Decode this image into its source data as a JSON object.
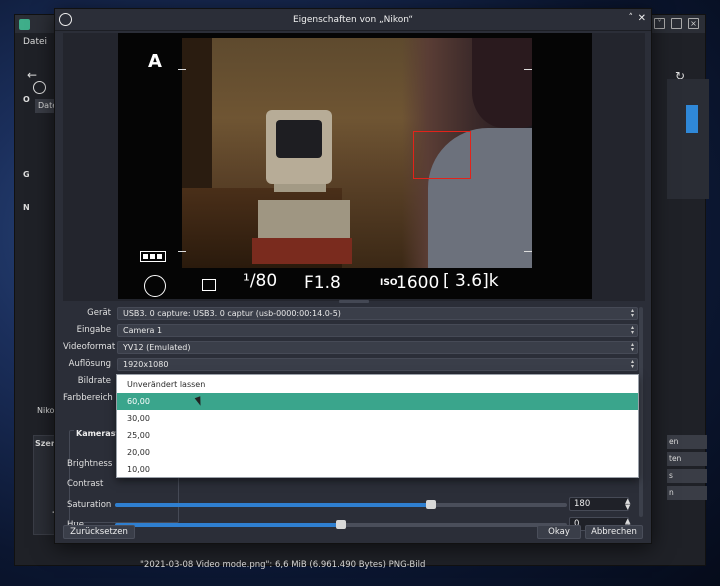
{
  "background_window": {
    "menu_item": "Datei",
    "left_letters": [
      "O",
      "G",
      "N"
    ],
    "date_tab": "Date",
    "nikon_label": "Nikon",
    "scenes_label": "Szene",
    "add_button": "+",
    "controls": [
      "en",
      "ten",
      "s",
      "n"
    ],
    "file_info": "\"2021-03-08 Video mode.png\": 6,6 MiB (6.961.490 Bytes) PNG-Bild"
  },
  "dialog": {
    "title": "Eigenschaften von „Nikon“",
    "collapse_glyph": "˄",
    "close_glyph": "✕"
  },
  "camera_hud": {
    "mode": "A",
    "shutter": "¹/80",
    "aperture": "F1.8",
    "iso_label": "ISO",
    "iso": "1600",
    "shots_remaining": "[ 3.6]k"
  },
  "properties": {
    "rows": [
      {
        "label": "Gerät",
        "value": "USB3. 0 capture: USB3. 0 captur (usb-0000:00:14.0-5)"
      },
      {
        "label": "Eingabe",
        "value": "Camera 1"
      },
      {
        "label": "Videoformat",
        "value": "YV12 (Emulated)"
      },
      {
        "label": "Auflösung",
        "value": "1920x1080"
      },
      {
        "label": "Bildrate",
        "value": ""
      },
      {
        "label": "Farbbereich",
        "value": ""
      }
    ],
    "camera_group_title": "Kamerasteuerung",
    "sliders": [
      {
        "label": "Brightness",
        "value": "",
        "fraction": null
      },
      {
        "label": "Contrast",
        "value": "",
        "fraction": null
      },
      {
        "label": "Saturation",
        "value": "180",
        "fraction": 0.7
      },
      {
        "label": "Hue",
        "value": "0",
        "fraction": 0.5
      }
    ]
  },
  "framerate_dropdown": {
    "options": [
      "Unverändert lassen",
      "60,00",
      "30,00",
      "25,00",
      "20,00",
      "10,00"
    ],
    "selected_index": 1
  },
  "footer": {
    "reset_label": "Zurücksetzen",
    "ok_label": "Okay",
    "cancel_label": "Abbrechen"
  },
  "colors": {
    "selection": "#3aa58c",
    "slider_fill": "#2f7fd0",
    "focus_box": "#e2231a"
  }
}
